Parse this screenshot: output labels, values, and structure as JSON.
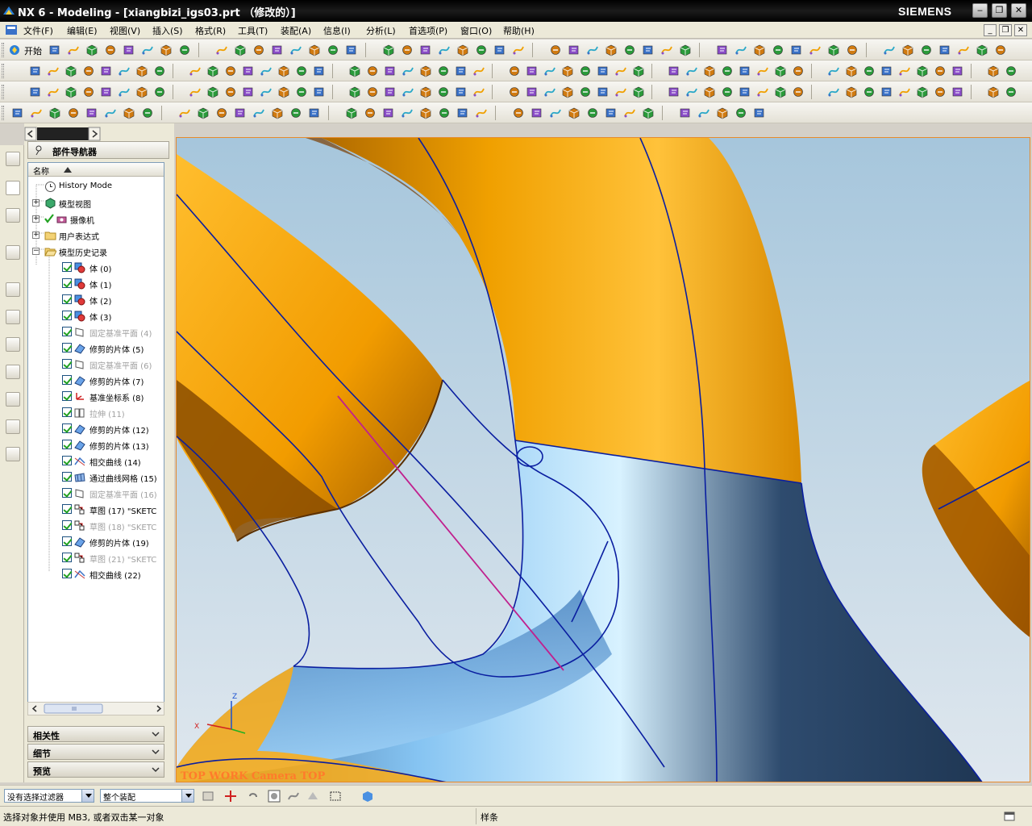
{
  "window": {
    "title": "NX 6 - Modeling - [xiangbizi_igs03.prt （修改的）]",
    "brand": "SIEMENS",
    "controls": {
      "minimize": "‒",
      "restore": "❐",
      "close": "✕"
    }
  },
  "menubar": {
    "items": [
      "文件(F)",
      "编辑(E)",
      "视图(V)",
      "插入(S)",
      "格式(R)",
      "工具(T)",
      "装配(A)",
      "信息(I)",
      "分析(L)",
      "首选项(P)",
      "窗口(O)",
      "帮助(H)"
    ]
  },
  "toolbar": {
    "start_label": "开始"
  },
  "navigator": {
    "title": "部件导航器",
    "column_header": "名称",
    "top_nodes": [
      {
        "label": "History Mode",
        "icon": "clock-icon"
      },
      {
        "label": "模型视图",
        "icon": "cube-view-icon",
        "expander": "+"
      },
      {
        "label": "摄像机",
        "icon": "camera-icon",
        "expander": "+"
      },
      {
        "label": "用户表达式",
        "icon": "folder-icon",
        "expander": "+"
      },
      {
        "label": "模型历史记录",
        "icon": "folder-open-icon",
        "expander": "−"
      }
    ],
    "history": [
      {
        "label": "体 (0)",
        "icon": "body-icon",
        "dim": false
      },
      {
        "label": "体 (1)",
        "icon": "body-icon",
        "dim": false
      },
      {
        "label": "体 (2)",
        "icon": "body-icon",
        "dim": false
      },
      {
        "label": "体 (3)",
        "icon": "body-icon",
        "dim": false
      },
      {
        "label": "固定基准平面 (4)",
        "icon": "datum-plane-icon",
        "dim": true
      },
      {
        "label": "修剪的片体 (5)",
        "icon": "trimmed-sheet-icon",
        "dim": false
      },
      {
        "label": "固定基准平面 (6)",
        "icon": "datum-plane-icon",
        "dim": true
      },
      {
        "label": "修剪的片体 (7)",
        "icon": "trimmed-sheet-icon",
        "dim": false
      },
      {
        "label": "基准坐标系 (8)",
        "icon": "datum-csys-icon",
        "dim": false
      },
      {
        "label": "拉伸 (11)",
        "icon": "extrude-icon",
        "dim": true
      },
      {
        "label": "修剪的片体 (12)",
        "icon": "trimmed-sheet-icon",
        "dim": false
      },
      {
        "label": "修剪的片体 (13)",
        "icon": "trimmed-sheet-icon",
        "dim": false
      },
      {
        "label": "相交曲线 (14)",
        "icon": "intersection-curve-icon",
        "dim": false
      },
      {
        "label": "通过曲线网格 (15)",
        "icon": "curve-mesh-icon",
        "dim": false
      },
      {
        "label": "固定基准平面 (16)",
        "icon": "datum-plane-icon",
        "dim": true
      },
      {
        "label": "草图 (17) \"SKETC",
        "icon": "sketch-icon",
        "dim": false
      },
      {
        "label": "草图 (18) \"SKETC",
        "icon": "sketch-icon",
        "dim": true
      },
      {
        "label": "修剪的片体 (19)",
        "icon": "trimmed-sheet-icon",
        "dim": false
      },
      {
        "label": "草图 (21) \"SKETC",
        "icon": "sketch-icon",
        "dim": true
      },
      {
        "label": "相交曲线 (22)",
        "icon": "intersection-curve-icon",
        "dim": false
      }
    ],
    "panels": [
      "相关性",
      "细节",
      "预览"
    ]
  },
  "viewport": {
    "label": "TOP WORK Camera TOP",
    "axis": {
      "x": "X",
      "z": "Z"
    }
  },
  "selection": {
    "filter": "没有选择过滤器",
    "scope": "整个装配"
  },
  "status": {
    "prompt": "选择对象并使用 MB3, 或者双击某一对象",
    "message": "样条"
  },
  "colors": {
    "surface_orange": "#f6a400",
    "surface_blue": "#7fbef0",
    "curve_blue": "#0a1ea0",
    "curve_magenta": "#c0208e",
    "viewport_border": "#e58a2c"
  }
}
